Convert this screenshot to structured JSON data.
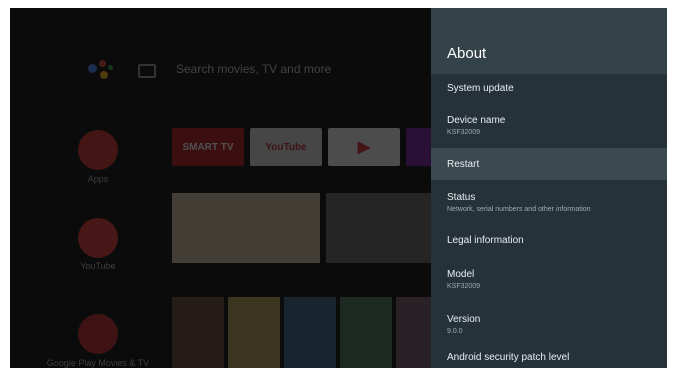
{
  "launcher": {
    "search_placeholder": "Search movies, TV and more",
    "apps": [
      {
        "label": "Apps",
        "color": "#d32f2f"
      },
      {
        "label": "YouTube",
        "color": "#e53935"
      },
      {
        "label": "Google Play Movies & TV",
        "color": "#c62828"
      }
    ],
    "tiles": [
      {
        "label": "SMART TV",
        "color": "#b71c1c"
      },
      {
        "label": "YouTube",
        "color": "#e0e0e0"
      },
      {
        "label": "",
        "color": "#f4f4f4"
      }
    ]
  },
  "panel": {
    "title": "About",
    "items": [
      {
        "title": "System update",
        "subtitle": ""
      },
      {
        "title": "Device name",
        "subtitle": "KSF32009"
      },
      {
        "title": "Restart",
        "subtitle": ""
      },
      {
        "title": "Status",
        "subtitle": "Network, serial numbers and other information"
      },
      {
        "title": "Legal information",
        "subtitle": ""
      },
      {
        "title": "Model",
        "subtitle": "KSF32009"
      },
      {
        "title": "Version",
        "subtitle": "9.0.0"
      },
      {
        "title": "Android security patch level",
        "subtitle": ""
      }
    ]
  },
  "colors": {
    "panel_bg": "#26323a",
    "header_bg": "#344249",
    "selected_bg": "#3b4950"
  }
}
